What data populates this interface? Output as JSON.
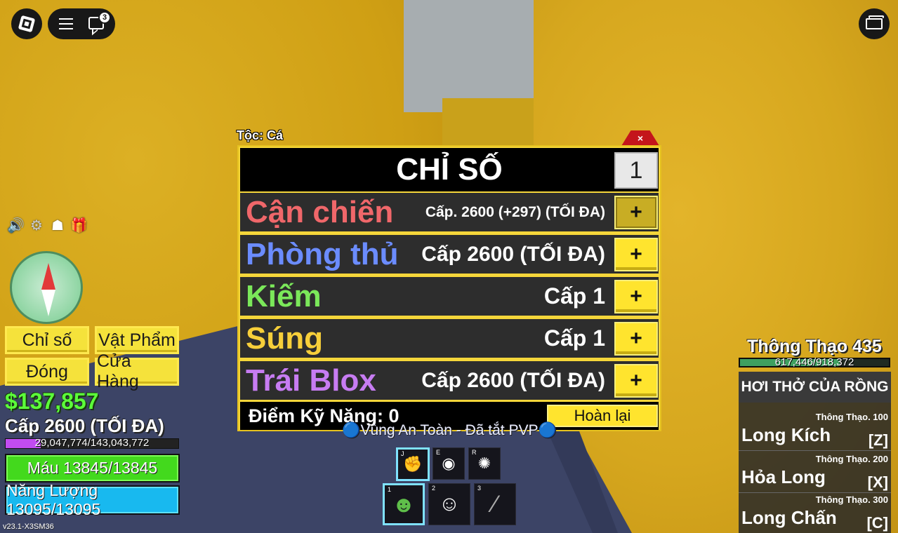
{
  "topbar": {
    "chat_badge": "3"
  },
  "stats_panel": {
    "race_label": "Tộc: Cá",
    "close_label": "×",
    "title": "CHỈ SỐ",
    "point_amount": "1",
    "rows": [
      {
        "name": "Cận chiến",
        "level": "Cấp. 2600 (+297) (TỐI ĐA)",
        "color": "#f0676a"
      },
      {
        "name": "Phòng thủ",
        "level": "Cấp 2600 (TỐI ĐA)",
        "color": "#6b8cff"
      },
      {
        "name": "Kiếm",
        "level": "Cấp 1",
        "color": "#7be85a"
      },
      {
        "name": "Súng",
        "level": "Cấp 1",
        "color": "#f7cf3a"
      },
      {
        "name": "Trái Blox",
        "level": "Cấp 2600 (TỐI ĐA)",
        "color": "#c77cf2"
      }
    ],
    "plus_label": "+",
    "skill_points": "Điểm Kỹ Năng: 0",
    "reset_label": "Hoàn lại"
  },
  "left_hud": {
    "buttons": [
      "Chỉ số",
      "Vật Phẩm",
      "Đóng",
      "Cửa Hàng"
    ],
    "money": "$137,857",
    "level": "Cấp 2600 (TỐI ĐA)",
    "xp_text": "29,047,774/143,043,772",
    "xp_fraction": 0.203,
    "health_text": "Máu 13845/13845",
    "health_fraction": 1.0,
    "energy_text": "Năng Lượng 13095/13095",
    "energy_fraction": 1.0,
    "version": "v23.1-X3SM36"
  },
  "safe_zone": "🔵Vùng An Toàn - Đã tắt PVP🔵",
  "hotbar": {
    "abilities": [
      {
        "key": "J",
        "icon": "haki-fist-icon"
      },
      {
        "key": "E",
        "icon": "eye-icon"
      },
      {
        "key": "R",
        "icon": "dragon-claw-icon"
      }
    ],
    "items": [
      {
        "key": "1",
        "icon": "fishman-character-icon"
      },
      {
        "key": "2",
        "icon": "rabbit-mask-icon"
      },
      {
        "key": "3",
        "icon": "sword-icon"
      }
    ]
  },
  "fighting_style": {
    "name": "Thông Thạo 435",
    "mastery_text": "617,446/918,372",
    "mastery_fraction": 0.672,
    "header": "HƠI THỞ CỦA RỒNG",
    "moves": [
      {
        "requirement": "Thông Thạo. 100",
        "name": "Long Kích",
        "key": "[Z]"
      },
      {
        "requirement": "Thông Thạo. 200",
        "name": "Hỏa Long",
        "key": "[X]"
      },
      {
        "requirement": "Thông Thạo. 300",
        "name": "Long Chấn",
        "key": "[C]"
      }
    ]
  }
}
